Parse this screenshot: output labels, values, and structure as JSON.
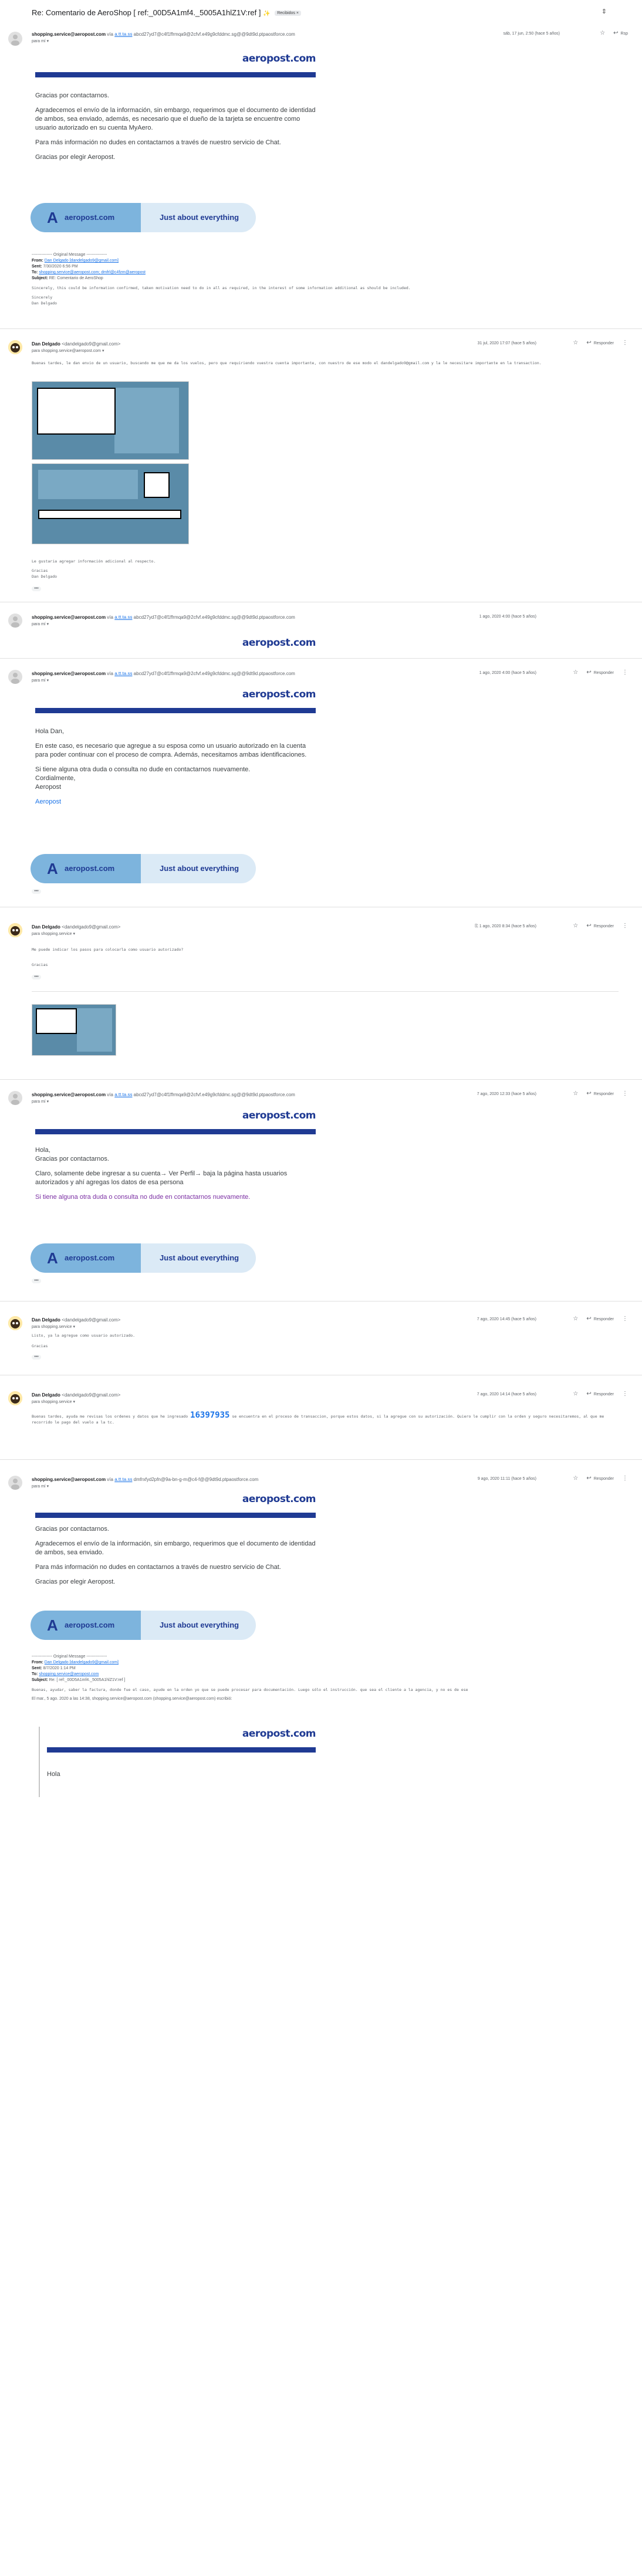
{
  "subject": {
    "title": "Re: Comentario de AeroShop [ ref:_00D5A1mf4._5005A1hlZ1V:ref ]",
    "sparkle": "✨",
    "label": "Recibidos ×"
  },
  "messages": [
    {
      "sender": "shopping.service@aeropost.com",
      "via": "a.tt.ta.ss",
      "via_rest": "abcd27yd7@c4f1ffrmqa9@2cfvf.e49g9cfddmc.sg@@9dt9d.ptpaostforce.com",
      "to": "para mí",
      "date": "sáb, 17 jun, 2:50 (hace 5 años)",
      "logo": "aeropost.com",
      "body": [
        "Gracias por contactarnos.",
        "Agradecemos el envío de la información, sin embargo, requerimos que el documento de identidad de ambos, sea enviado, además, es necesario que el dueño de la tarjeta se encuentre como usuario autorizado en su cuenta MyAero.",
        "Para más información no dudes en contactarnos a través de nuestro servicio de Chat.",
        "Gracias por elegir Aeropost."
      ],
      "banner_brand": "aeropost.com",
      "banner_tag": "Just about everything",
      "quote": {
        "header": "--------------- Original Message ---------------",
        "from": "Dan Delgado [dandelgado9@gmail.com]",
        "sent": "7/30/2020 6:56 PM",
        "to": "shopping.service@aeropost.com; dmfrl@c4fzm@aeropost",
        "subject": "RE: Comentario de AeroShop",
        "body": "Sincerely, this could be information confirmed, taken motivation need to do in all as required, in the interest of some information additional as should be included.",
        "sign": "Sincerely\nDan Delgado"
      }
    },
    {
      "sender": "Dan Delgado",
      "addr": "<dandelgado9@gmail.com>",
      "to": "para shopping.service@aeropost.com",
      "date": "31 jul, 2020 17:07 (hace 5 años)",
      "reply": "Responder",
      "body": "Buenas tardes, le dan envio de un usuario, buscando me que me da los vuelos, pero que requiriendo vuestra cuenta importante, con nuestro de ese modo el dandelgado9@gmail.com y la le necesitare importante en la transaction.",
      "caption": "Le gustaria agregar información adicional al respecto.",
      "sign": "Gracias\nDan Delgado"
    },
    {
      "sender": "shopping.service@aeropost.com",
      "via": "a.tt.ta.ss",
      "via_rest": "abcd27yd7@c4f1ffrmqa9@2cfvf.e49g9cfddmc.sg@@9dt9d.ptpaostforce.com",
      "to": "para mí",
      "date": "1 ago, 2020 4:00 (hace 5 años)",
      "logo": "aeropost.com"
    },
    {
      "sender": "shopping.service@aeropost.com",
      "via": "a.tt.ta.ss",
      "via_rest": "abcd27yd7@c4f1ffrmqa9@2cfvf.e49g9cfddmc.sg@@9dt9d.ptpaostforce.com",
      "to": "para mí",
      "date": "1 ago, 2020 4:00 (hace 5 años)",
      "reply": "Responder",
      "logo": "aeropost.com",
      "body": [
        "Hola Dan,",
        "En este caso, es necesario que agregue a su esposa como un usuario autorizado en la cuenta para poder continuar con el proceso de compra. Además, necesitamos ambas identificaciones.",
        "Si tiene alguna otra duda o consulta no dude en contactarnos nuevamente.\nCordialmente,\nAeropost"
      ],
      "signature_link": "Aeropost",
      "banner_brand": "aeropost.com",
      "banner_tag": "Just about everything"
    },
    {
      "sender": "Dan Delgado",
      "addr": "<dandelgado9@gmail.com>",
      "to": "para shopping.service",
      "date": "1 ago, 2020 8:34 (hace 5 años)",
      "reply": "Responder",
      "body": "Me puede indicar los pasos para colocarla como usuario autorizado?",
      "sign": "Gracias"
    },
    {
      "sender": "shopping.service@aeropost.com",
      "via": "a.tt.ta.ss",
      "via_rest": "abcd27yd7@c4f1ffrmqa9@2cfvf.e49g9cfddmc.sg@@9dt9d.ptpaostforce.com",
      "to": "para mí",
      "date": "7 ago, 2020 12:33 (hace 5 años)",
      "reply": "Responder",
      "logo": "aeropost.com",
      "body": [
        "Hola,\nGracias por contactarnos.",
        "Claro, solamente debe ingresar a su cuenta→ Ver Perfil→ baja la página hasta usuarios autorizados y ahí agregas los datos de esa persona"
      ],
      "purple_line": "Si tiene alguna otra duda o consulta no dude en contactarnos nuevamente.",
      "banner_brand": "aeropost.com",
      "banner_tag": "Just about everything"
    },
    {
      "sender": "Dan Delgado",
      "addr": "<dandelgado9@gmail.com>",
      "to": "para shopping.service",
      "date": "7 ago, 2020 14:45 (hace 5 años)",
      "reply": "Responder",
      "body": "Listo, ya la agregue como usuario autorizado.",
      "sign": "Gracias"
    },
    {
      "sender": "Dan Delgado",
      "addr": "<dandelgado9@gmail.com>",
      "to": "para shopping.service",
      "date": "7 ago, 2020 14:14 (hace 5 años)",
      "reply": "Responder",
      "body": "Buenas tardes, ayuda me revisas los ordenes y datos que he ingresado",
      "order_number": "16397935",
      "body2": "se encuentra en el proceso de transaccion, porque estos datos, si la agregue con su autorización. Quiero le cumplir con la orden y seguro necesitaremos, al que me recorrido le pago del vuelo a la tc."
    },
    {
      "sender": "shopping.service@aeropost.com",
      "via": "a.tt.ta.ss",
      "via_rest": "dmfrxfyd2pfn@9a-bn-g-m@c4-f@@9dt9d.ptpaostforce.com",
      "to": "para mí",
      "date": "9 ago, 2020 11:11 (hace 5 años)",
      "reply": "Responder",
      "logo": "aeropost.com",
      "body": [
        "Gracias por contactarnos.",
        "Agradecemos el envío de la información, sin embargo, requerimos que el documento de identidad de ambos, sea enviado.",
        "Para más información no dudes en contactarnos a través de nuestro servicio de Chat.",
        "Gracias por elegir Aeropost."
      ],
      "banner_brand": "aeropost.com",
      "banner_tag": "Just about everything",
      "quote": {
        "header": "--------------- Original Message ---------------",
        "from": "Dan Delgado [dandelgado9@gmail.com]",
        "sent": "8/7/2020 1:14 PM",
        "to": "shopping.service@aeropost.com",
        "subject": "Re: [ ref:_00D5A1mf4._5005A1hlZ1V:ref ]",
        "body": "Buenas, ayudar, saber la factura, donde fue el caso, ayude en la orden yo que se puede procesar para documentación. Luego sólo el instrucción. que sea el cliente a la agencia, y no es de ese",
        "wrote": "El mar., 5 ago. 2020 a las 14:38, shopping.service@aeropost.com (shopping.service@aeropost.com) escribió:",
        "logo": "aeropost.com",
        "greeting": "Hola"
      }
    }
  ]
}
